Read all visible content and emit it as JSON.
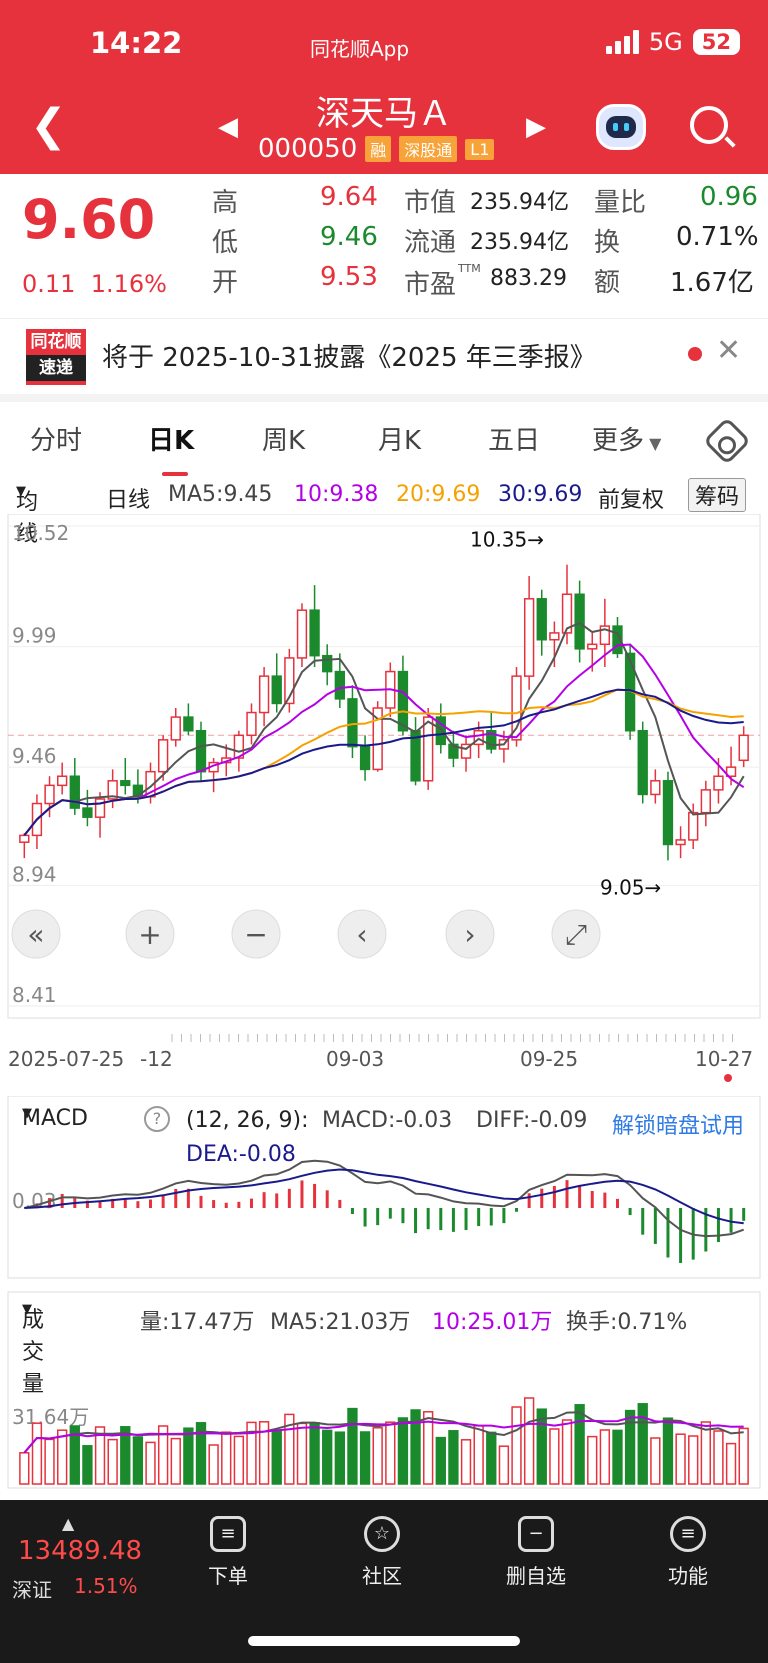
{
  "status": {
    "time": "14:22",
    "app": "同花顺App",
    "network": "5G",
    "battery": "52"
  },
  "header": {
    "title": "深天马Ａ",
    "code": "000050",
    "tags": [
      "融",
      "深股通",
      "L1"
    ]
  },
  "quote": {
    "price": "9.60",
    "change": "0.11",
    "change_pct": "1.16%",
    "high_label": "高",
    "high": "9.64",
    "low_label": "低",
    "low": "9.46",
    "open_label": "开",
    "open": "9.53",
    "mktcap_label": "市值",
    "mktcap": "235.94亿",
    "float_label": "流通",
    "float": "235.94亿",
    "pe_label": "市盈",
    "pe_sup": "TTM",
    "pe": "883.29",
    "volratio_label": "量比",
    "volratio": "0.96",
    "turnover_label": "换",
    "turnover": "0.71%",
    "amount_label": "额",
    "amount": "1.67亿"
  },
  "notice": {
    "badge_top": "同花顺",
    "badge_bottom": "速递",
    "text": "将于 2025-10-31披露《2025 年三季报》"
  },
  "tabs": [
    "分时",
    "日K",
    "周K",
    "月K",
    "五日",
    "更多"
  ],
  "ma_bar": {
    "selector": "均线",
    "type": "日线",
    "ma5": "MA5:9.45",
    "ma10": "10:9.38",
    "ma20": "20:9.69",
    "ma30": "30:9.69",
    "adjust": "前复权",
    "chip_btn": "筹码"
  },
  "kline_labels": {
    "y_ticks": [
      "10.52",
      "9.99",
      "9.46",
      "8.94",
      "8.41"
    ],
    "x_ticks": [
      "2025-07-25",
      "-12",
      "09-03",
      "09-25",
      "10-27"
    ],
    "high_mark": "10.35→",
    "low_mark": "9.05→"
  },
  "macd": {
    "selector": "MACD",
    "params": "(12, 26, 9):",
    "macd": "MACD:-0.03",
    "diff": "DIFF:-0.09",
    "dea": "DEA:-0.08",
    "unlock": "解锁暗盘试用",
    "tick": "0.03"
  },
  "volume": {
    "selector": "成交量",
    "vol": "量:17.47万",
    "ma5": "MA5:21.03万",
    "ma10": "10:25.01万",
    "turnover": "换手:0.71%",
    "tick": "31.64万"
  },
  "bottom": {
    "index_value": "13489.48",
    "index_name": "深证",
    "index_pct": "1.51%",
    "items": [
      "下单",
      "社区",
      "删自选",
      "功能"
    ]
  },
  "colors": {
    "up": "#e5323d",
    "down": "#1b8a2d",
    "ma5": "#555555",
    "ma10": "#b400e6",
    "ma20": "#f5a200",
    "ma30": "#1a1a8c"
  },
  "chart_data": {
    "type": "candlestick",
    "x_ticks": [
      "2025-07-25",
      "09-03",
      "09-25",
      "10-27"
    ],
    "ylim": [
      8.41,
      10.52
    ],
    "y_ticks": [
      10.52,
      9.99,
      9.46,
      8.94,
      8.41
    ],
    "annotations": [
      "10.35→",
      "9.05→"
    ],
    "candles": [
      [
        9.13,
        9.17,
        9.06,
        9.16
      ],
      [
        9.16,
        9.34,
        9.1,
        9.3
      ],
      [
        9.3,
        9.42,
        9.24,
        9.38
      ],
      [
        9.38,
        9.48,
        9.34,
        9.42
      ],
      [
        9.42,
        9.5,
        9.25,
        9.28
      ],
      [
        9.28,
        9.36,
        9.2,
        9.24
      ],
      [
        9.24,
        9.35,
        9.15,
        9.32
      ],
      [
        9.32,
        9.45,
        9.28,
        9.4
      ],
      [
        9.4,
        9.5,
        9.34,
        9.38
      ],
      [
        9.38,
        9.45,
        9.3,
        9.33
      ],
      [
        9.33,
        9.48,
        9.3,
        9.44
      ],
      [
        9.44,
        9.6,
        9.4,
        9.58
      ],
      [
        9.58,
        9.72,
        9.55,
        9.68
      ],
      [
        9.68,
        9.74,
        9.6,
        9.62
      ],
      [
        9.62,
        9.66,
        9.4,
        9.44
      ],
      [
        9.44,
        9.5,
        9.35,
        9.48
      ],
      [
        9.48,
        9.56,
        9.42,
        9.5
      ],
      [
        9.5,
        9.62,
        9.44,
        9.6
      ],
      [
        9.6,
        9.74,
        9.56,
        9.7
      ],
      [
        9.7,
        9.9,
        9.64,
        9.86
      ],
      [
        9.86,
        9.96,
        9.7,
        9.74
      ],
      [
        9.74,
        9.98,
        9.7,
        9.94
      ],
      [
        9.94,
        10.18,
        9.9,
        10.15
      ],
      [
        10.15,
        10.26,
        9.9,
        9.95
      ],
      [
        9.95,
        10.0,
        9.82,
        9.88
      ],
      [
        9.88,
        9.96,
        9.72,
        9.76
      ],
      [
        9.76,
        9.82,
        9.5,
        9.55
      ],
      [
        9.55,
        9.6,
        9.4,
        9.45
      ],
      [
        9.45,
        9.75,
        9.44,
        9.72
      ],
      [
        9.72,
        9.92,
        9.68,
        9.88
      ],
      [
        9.88,
        9.95,
        9.6,
        9.62
      ],
      [
        9.62,
        9.68,
        9.38,
        9.4
      ],
      [
        9.4,
        9.72,
        9.36,
        9.68
      ],
      [
        9.68,
        9.74,
        9.52,
        9.56
      ],
      [
        9.56,
        9.62,
        9.46,
        9.5
      ],
      [
        9.5,
        9.6,
        9.44,
        9.56
      ],
      [
        9.56,
        9.66,
        9.5,
        9.62
      ],
      [
        9.62,
        9.7,
        9.52,
        9.54
      ],
      [
        9.54,
        9.62,
        9.48,
        9.58
      ],
      [
        9.58,
        9.9,
        9.55,
        9.86
      ],
      [
        9.86,
        10.3,
        9.8,
        10.2
      ],
      [
        10.2,
        10.24,
        9.95,
        10.02
      ],
      [
        10.02,
        10.1,
        9.9,
        10.05
      ],
      [
        10.05,
        10.35,
        10.0,
        10.22
      ],
      [
        10.22,
        10.28,
        9.92,
        9.98
      ],
      [
        9.98,
        10.05,
        9.88,
        10.0
      ],
      [
        10.0,
        10.2,
        9.9,
        10.08
      ],
      [
        10.08,
        10.12,
        9.94,
        9.96
      ],
      [
        9.96,
        10.0,
        9.58,
        9.62
      ],
      [
        9.62,
        9.66,
        9.3,
        9.34
      ],
      [
        9.34,
        9.45,
        9.3,
        9.4
      ],
      [
        9.4,
        9.44,
        9.05,
        9.12
      ],
      [
        9.12,
        9.2,
        9.06,
        9.14
      ],
      [
        9.14,
        9.3,
        9.1,
        9.26
      ],
      [
        9.26,
        9.4,
        9.2,
        9.36
      ],
      [
        9.36,
        9.5,
        9.3,
        9.42
      ],
      [
        9.42,
        9.55,
        9.38,
        9.46
      ],
      [
        9.49,
        9.64,
        9.46,
        9.6
      ]
    ]
  }
}
